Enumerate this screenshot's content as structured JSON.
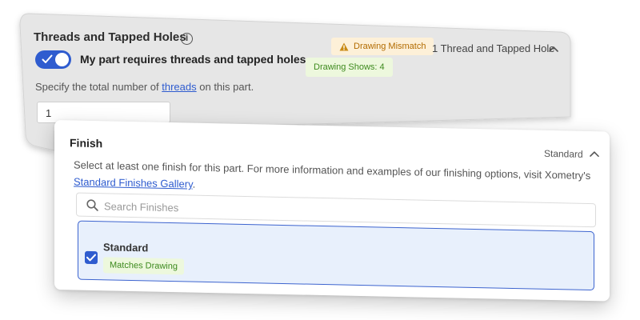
{
  "threads": {
    "title": "Threads and Tapped Holes",
    "info_icon": "info-icon",
    "info_glyph": "i",
    "toggle_on": true,
    "toggle_label": "My part requires threads and tapped holes",
    "mismatch_badge": "Drawing Mismatch",
    "drawing_shows_badge": "Drawing Shows: 4",
    "summary": "1 Thread and Tapped Hole",
    "specify_prefix": "Specify the total number of ",
    "specify_link": "threads",
    "specify_suffix": " on this part.",
    "quantity_value": "1"
  },
  "finish": {
    "title": "Finish",
    "summary": "Standard",
    "description": "Select at least one finish for this part. For more information and examples of our finishing options, visit Xometry's ",
    "gallery_link": "Standard Finishes Gallery",
    "description_suffix": ".",
    "search_placeholder": "Search Finishes",
    "option": {
      "label": "Standard",
      "checked": true,
      "badge": "Matches Drawing"
    }
  },
  "colors": {
    "accent": "#2f5ccf",
    "warning_text": "#b26b00",
    "warning_bg": "#fdf0d8",
    "success_text": "#3d8a1e",
    "success_bg": "#edf8dd",
    "selected_bg": "#e8f0fc",
    "threads_card_bg": "#e6e6e6"
  }
}
